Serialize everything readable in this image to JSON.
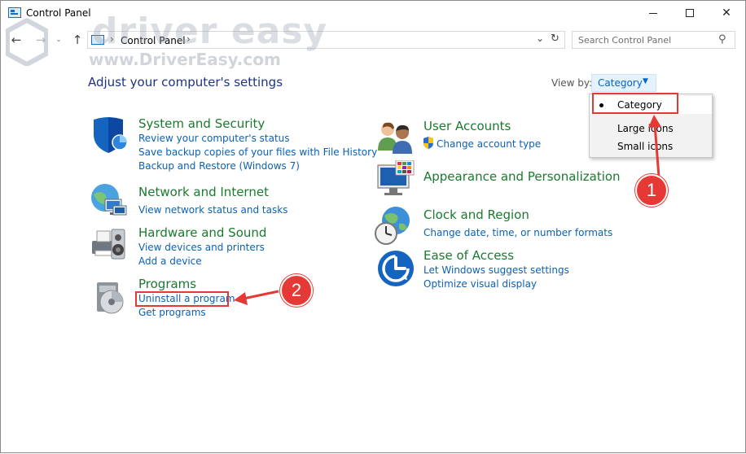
{
  "window": {
    "title": "Control Panel"
  },
  "watermark": {
    "brand": "driver easy",
    "url": "www.DriverEasy.com"
  },
  "nav": {
    "back_glyph": "←",
    "forward_glyph": "→",
    "recent_glyph": "⌄",
    "up_glyph": "↑",
    "breadcrumb": [
      "Control Panel"
    ],
    "search_placeholder": "Search Control Panel"
  },
  "header": {
    "title": "Adjust your computer's settings",
    "view_by_label": "View by:",
    "view_by_value": "Category"
  },
  "view_menu": {
    "options": [
      "Category",
      "Large icons",
      "Small icons"
    ],
    "selected": "Category"
  },
  "categories": [
    {
      "title": "System and Security",
      "icon": "shield-icon",
      "links": [
        "Review your computer's status",
        "Save backup copies of your files with File History",
        "Backup and Restore (Windows 7)"
      ]
    },
    {
      "title": "Network and Internet",
      "icon": "network-globe-icon",
      "links": [
        "View network status and tasks"
      ]
    },
    {
      "title": "Hardware and Sound",
      "icon": "printer-speaker-icon",
      "links": [
        "View devices and printers",
        "Add a device"
      ]
    },
    {
      "title": "Programs",
      "icon": "programs-disc-icon",
      "links": [
        "Uninstall a program",
        "Get programs"
      ]
    },
    {
      "title": "User Accounts",
      "icon": "users-icon",
      "links": [
        "Change account type"
      ]
    },
    {
      "title": "Appearance and Personalization",
      "icon": "monitor-palette-icon",
      "links": []
    },
    {
      "title": "Clock and Region",
      "icon": "clock-globe-icon",
      "links": [
        "Change date, time, or number formats"
      ]
    },
    {
      "title": "Ease of Access",
      "icon": "ease-of-access-icon",
      "links": [
        "Let Windows suggest settings",
        "Optimize visual display"
      ]
    }
  ],
  "annotations": {
    "step1": "1",
    "step2": "2"
  },
  "colors": {
    "accent": "#e53935",
    "category_title": "#1a7a2e",
    "link": "#0b61b6",
    "heading": "#1e3287"
  }
}
